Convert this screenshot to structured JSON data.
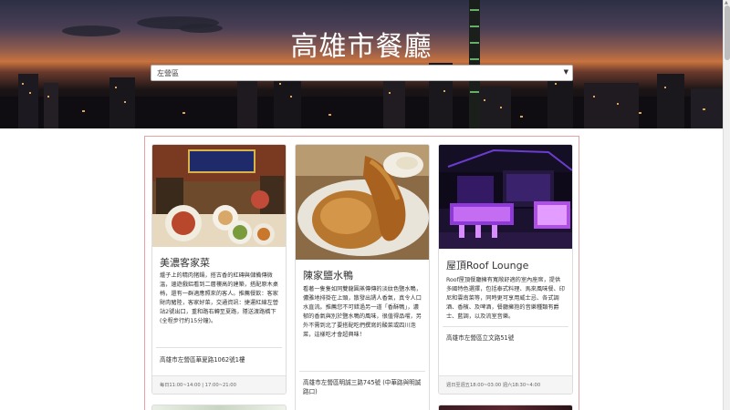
{
  "header": {
    "title": "高雄市餐廳",
    "district_select": {
      "selected": "左營區"
    }
  },
  "restaurants": [
    {
      "name": "美濃客家菜",
      "description": "爐子上的精肉猪鍋，搭古香的紅磚與儲備傳微溫，邊遊戲鋁看到二層樓高的建築，搭配原木桌椅，還有一群適應照來的客人。推薦餐飲：客家財肉豬陸，客家好菜，交通資訊：捷運紅線左營站2號出口，重和路右轉至夏路，隱送渡路橋下(全程步行約15分鐘)。",
      "address": "高雄市左營區華夏路1062號1樓",
      "hours": "每日11:00~14:00 | 17:00~21:00"
    },
    {
      "name": "陳家鹽水鴨",
      "description": "看著一隻隻如同雙龍圓蒸傳傳的淡紋色鹽水鴨，儂雅地排掛在上頭，散發出誘人香氣，真令人口水直流。推薦您不可錯過另一道「香酥鴨」，濃郁的香氣與別於鹽水鴨的風味，很值得品嚐，另外不需到北了要搭配吃們撰寫的酸菜或四川泡菜，這樣吃才會超興味！",
      "address": "高雄市左營區明誠三路745號 (中華路與明誠路口)"
    },
    {
      "name": "屋頂Roof Lounge",
      "description": "Roof屋頂餐廳擁有寬敞舒適的室內座席，提供多國特色選擇，包括泰式料理、馬來風味餐、印尼和雲南菜等，同時更可享用威士忌、各式調酒、香檳、及啤酒，餐廳擁抱的音樂種類有爵士、藍調，以及流室音樂。",
      "address": "高雄市左營區立文路51號",
      "hours": "週日至週五18:00~03:00 週六18:30~4:00"
    }
  ]
}
